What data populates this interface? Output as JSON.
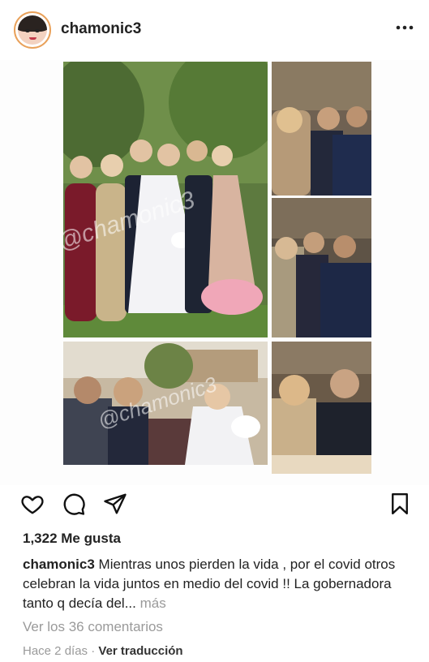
{
  "header": {
    "username": "chamonic3",
    "more_icon": "more-horizontal-icon"
  },
  "post": {
    "watermark_text": "@chamonic3",
    "images": [
      {
        "name": "wedding-group-photo"
      },
      {
        "name": "guests-greeting-photo"
      },
      {
        "name": "guests-embrace-photo"
      },
      {
        "name": "groom-bride-greeting-photo"
      },
      {
        "name": "guests-seated-photo"
      }
    ]
  },
  "actions": {
    "like_icon": "heart-icon",
    "comment_icon": "comment-icon",
    "share_icon": "send-icon",
    "save_icon": "bookmark-icon"
  },
  "likes_text": "1,322 Me gusta",
  "caption": {
    "username": "chamonic3",
    "text": "Mientras unos pierden la vida , por el covid otros celebran la vida juntos en medio del covid !! La gobernadora tanto q decía del...",
    "more_label": "más"
  },
  "comments_link": "Ver los 36 comentarios",
  "timestamp": "Hace 2 días",
  "separator": "·",
  "translate_label": "Ver traducción"
}
